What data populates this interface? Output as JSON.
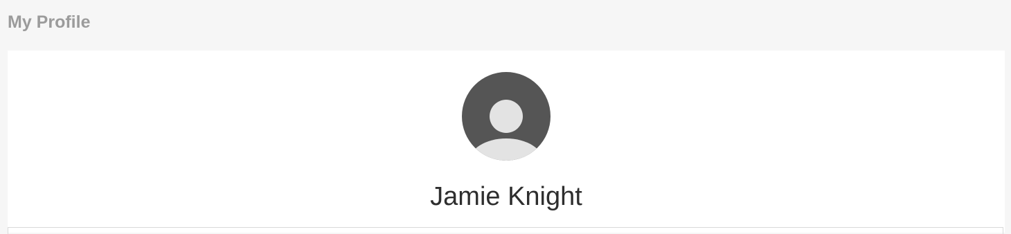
{
  "page": {
    "title": "My Profile"
  },
  "profile": {
    "name": "Jamie Knight",
    "avatar_icon": "default-user-avatar-icon"
  },
  "colors": {
    "background": "#f6f6f6",
    "card": "#ffffff",
    "title_text": "#9b9b9b",
    "name_text": "#2e2e2e",
    "avatar_bg": "#555555",
    "avatar_figure": "#e3e3e3"
  }
}
